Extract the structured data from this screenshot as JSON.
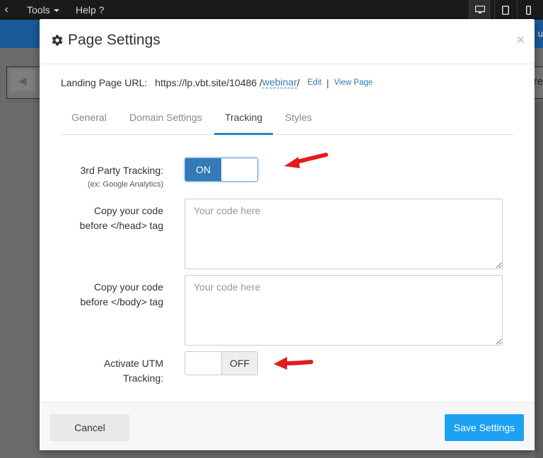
{
  "app": {
    "menu_tools": "Tools",
    "menu_help": "Help ?",
    "blue_bar_edge_text": "u",
    "canvas_edge_text": "re"
  },
  "modal": {
    "title": "Page Settings",
    "close_symbol": "×",
    "landing_label": "Landing Page URL:",
    "url_base": "https://lp.vbt.site/10486 /",
    "url_slug": "webinar",
    "url_trailing": "/",
    "edit_link": "Edit",
    "separator": "|",
    "view_link": "View Page",
    "tabs": [
      {
        "label": "General",
        "active": false
      },
      {
        "label": "Domain Settings",
        "active": false
      },
      {
        "label": "Tracking",
        "active": true
      },
      {
        "label": "Styles",
        "active": false
      }
    ],
    "tracking": {
      "third_party_label": "3rd Party Tracking:",
      "third_party_sub": "(ex: Google Analytics)",
      "third_party_state": "ON",
      "head_label_1": "Copy your code",
      "head_label_2": "before </head> tag",
      "head_placeholder": "Your code here",
      "body_label_1": "Copy your code",
      "body_label_2": "before </body> tag",
      "body_placeholder": "Your code here",
      "utm_label_1": "Activate UTM",
      "utm_label_2": "Tracking:",
      "utm_state": "OFF"
    },
    "cancel_label": "Cancel",
    "save_label": "Save Settings"
  },
  "colors": {
    "accent": "#337ab7",
    "save_button": "#1da1f2",
    "annotation_arrow": "#e31b1b"
  }
}
